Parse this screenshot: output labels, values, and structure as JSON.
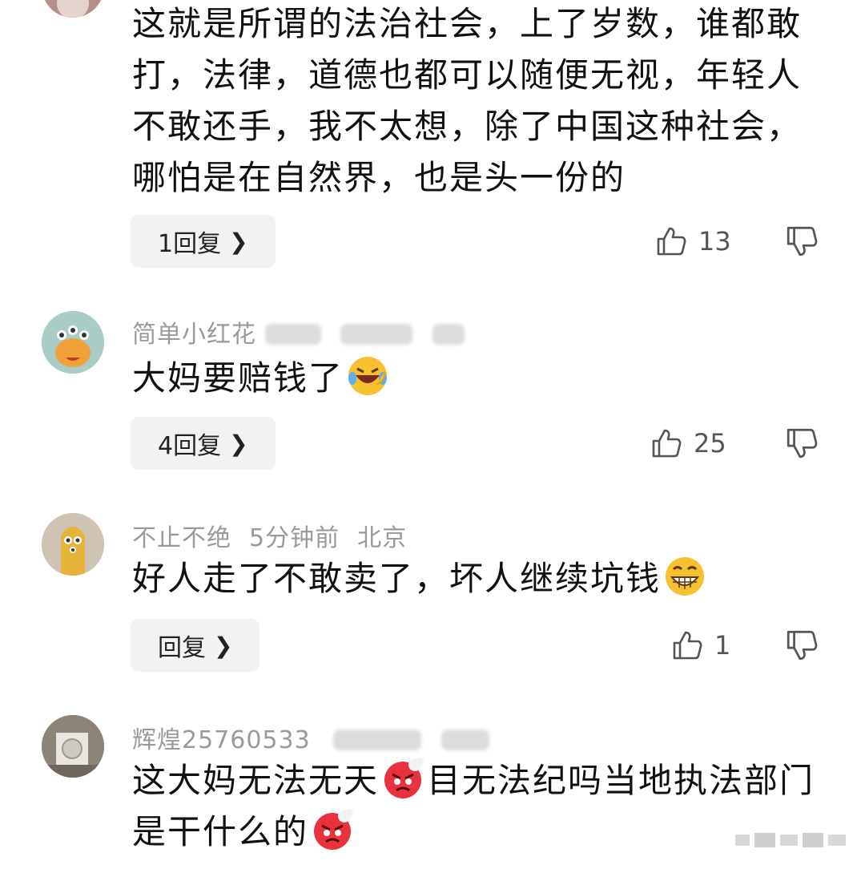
{
  "comments": [
    {
      "author": "",
      "meta": "",
      "text": "这就是所谓的法治社会，上了岁数，谁都敢打，法律，道德也都可以随便无视，年轻人不敢还手，我不太想，除了中国这种社会，哪怕是在自然界，也是头一份的",
      "reply_label": "1回复",
      "likes": "13"
    },
    {
      "author": "简单小红花",
      "meta": "",
      "text": "大妈要赔钱了",
      "emoji_after": "laugh-cry-emoji",
      "reply_label": "4回复",
      "likes": "25"
    },
    {
      "author": "不止不绝",
      "time": "5分钟前",
      "location": "北京",
      "text": "好人走了不敢卖了，坏人继续坑钱",
      "emoji_after": "grin-emoji",
      "reply_label": "回复",
      "likes": "1"
    },
    {
      "author": "辉煌25760533",
      "meta": "",
      "text_part1": "这大妈无法无天",
      "text_part2": "目无法纪吗当地执法部门是干什么的",
      "emoji_inline": "angry-emoji",
      "emoji_after": "angry-emoji"
    }
  ],
  "colors": {
    "meta_gray": "#9a9a9a",
    "reply_bg": "#f2f2f2",
    "text": "#111111"
  },
  "icons": {
    "like": "thumbs-up-icon",
    "dislike": "thumbs-down-icon",
    "reply_chevron": "chevron-right-icon"
  }
}
